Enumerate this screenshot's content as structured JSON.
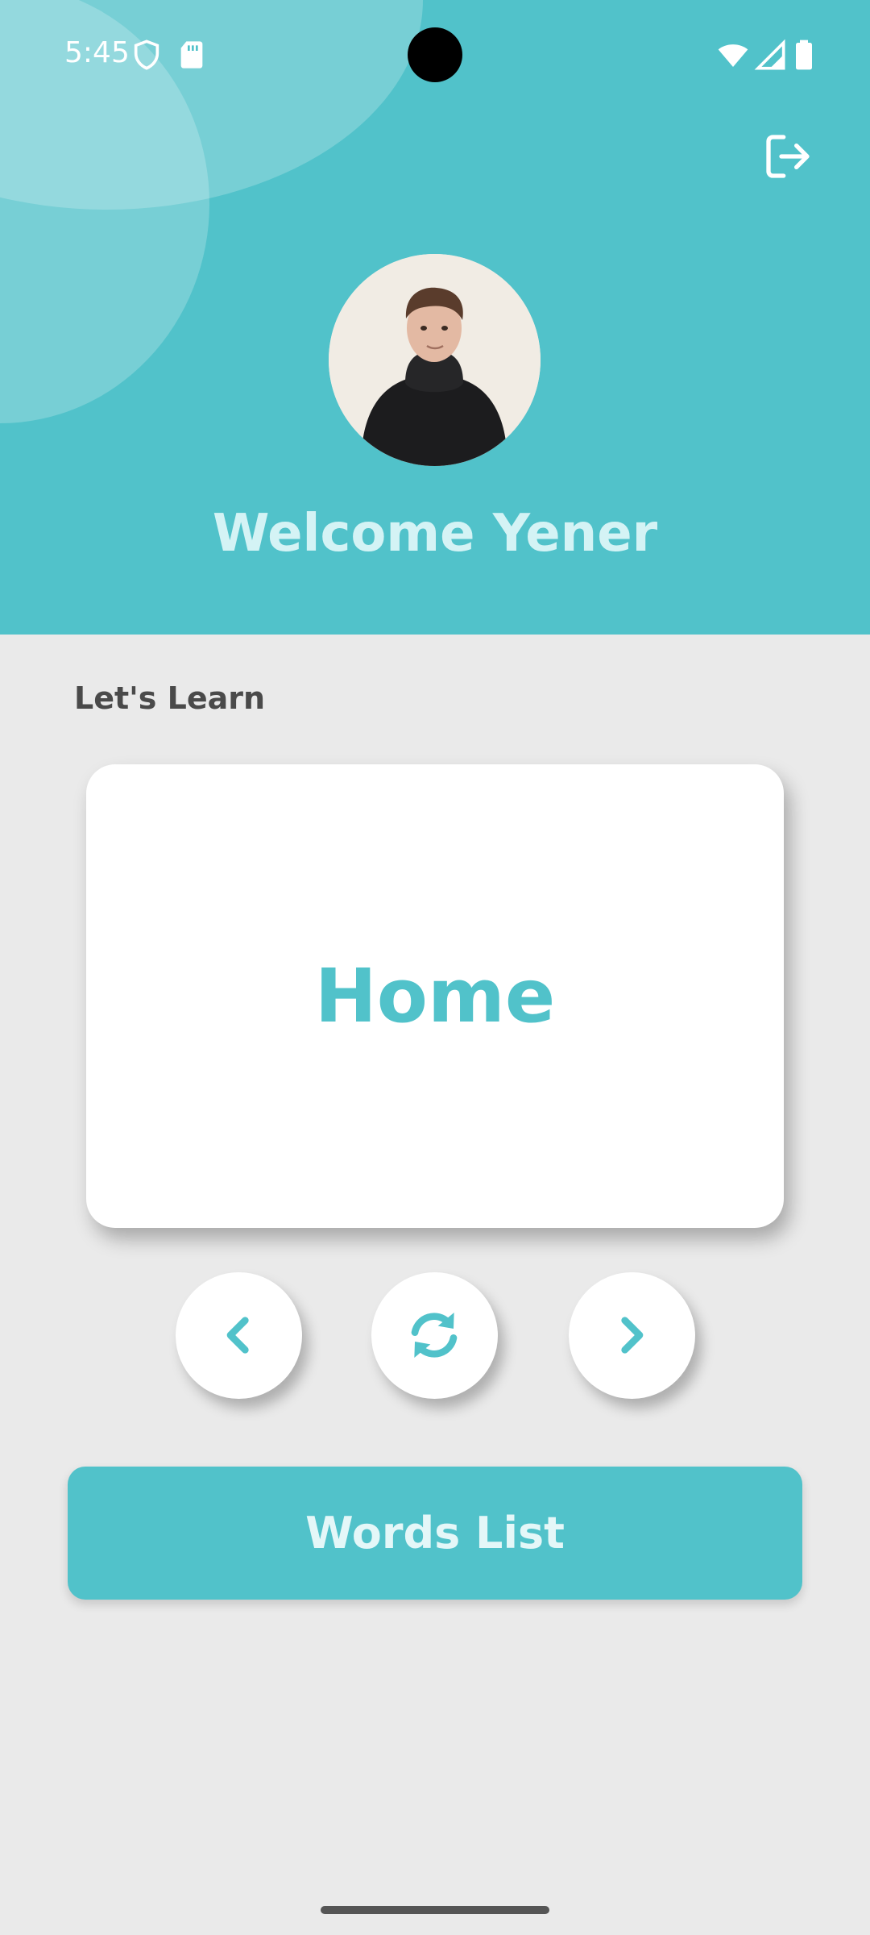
{
  "status_bar": {
    "time": "5:45"
  },
  "header": {
    "welcome_text": "Welcome Yener",
    "logout_icon": "logout-icon"
  },
  "learn": {
    "section_label": "Let's Learn",
    "current_word": "Home"
  },
  "controls": {
    "prev_icon": "chevron-left-icon",
    "refresh_icon": "refresh-icon",
    "next_icon": "chevron-right-icon"
  },
  "words_list_button": {
    "label": "Words List"
  },
  "colors": {
    "accent": "#51C2CA",
    "background": "#EAEAEA",
    "card": "#FFFFFF"
  }
}
